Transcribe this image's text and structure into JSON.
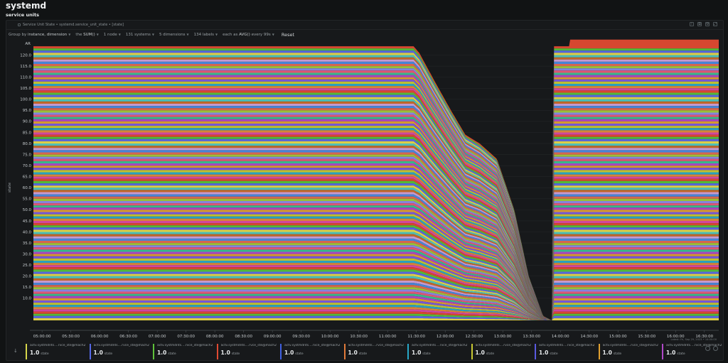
{
  "page": {
    "title": "systemd",
    "subtitle": "service units"
  },
  "card": {
    "title": "Service Unit State • systemd.service_unit_state • [state]",
    "icons": [
      "info-icon",
      "copy-icon",
      "settings-icon",
      "expand-icon"
    ]
  },
  "toolbar": {
    "group_by_label": "Group by",
    "group_by_value": "instance, dimension",
    "the_label": "the",
    "aggregation": "SUM()",
    "nodes": "1 node",
    "systems": "131 systems",
    "dimensions": "5 dimensions",
    "labels": "134 labels",
    "each_as_label": "each as",
    "each_as_value": "AVG()",
    "every": "every 99s",
    "reset": "Reset"
  },
  "chart_data": {
    "type": "area",
    "stacked": true,
    "ylabel": "state",
    "y_unit_label": "AR",
    "ylim": [
      0,
      125
    ],
    "y_ticks": [
      10.0,
      15.0,
      20.0,
      25.0,
      30.0,
      35.0,
      40.0,
      45.0,
      50.0,
      55.0,
      60.0,
      65.0,
      70.0,
      75.0,
      80.0,
      85.0,
      90.0,
      95.0,
      100.0,
      105.0,
      110.0,
      115.0,
      120.0
    ],
    "x_ticks": [
      "05:00:00",
      "05:30:00",
      "06:00:00",
      "06:30:00",
      "07:00:00",
      "07:30:00",
      "08:00:00",
      "08:30:00",
      "09:00:00",
      "09:30:00",
      "10:00:00",
      "10:30:00",
      "11:00:00",
      "11:30:00",
      "12:00:00",
      "12:30:00",
      "13:00:00",
      "13:30:00",
      "14:00:00",
      "14:30:00",
      "15:00:00",
      "15:30:00",
      "16:00:00",
      "16:30:00"
    ],
    "x_range_hours": [
      4.85,
      16.75
    ],
    "series_count": 124,
    "series_value_each": 1.0,
    "stack_total_profile": [
      {
        "t": 4.85,
        "total": 124
      },
      {
        "t": 11.45,
        "total": 124
      },
      {
        "t": 11.55,
        "total": 121
      },
      {
        "t": 11.8,
        "total": 109
      },
      {
        "t": 12.1,
        "total": 95
      },
      {
        "t": 12.35,
        "total": 84
      },
      {
        "t": 12.6,
        "total": 80
      },
      {
        "t": 12.9,
        "total": 73
      },
      {
        "t": 13.2,
        "total": 50
      },
      {
        "t": 13.45,
        "total": 20
      },
      {
        "t": 13.7,
        "total": 2
      },
      {
        "t": 13.85,
        "total": 0
      },
      {
        "t": 13.88,
        "total": 124
      },
      {
        "t": 14.15,
        "total": 124
      },
      {
        "t": 14.17,
        "total": 127
      },
      {
        "t": 16.75,
        "total": 127
      }
    ],
    "grid": true,
    "legend": "bottom"
  },
  "legend": {
    "items": [
      {
        "name": "actv.systmdnts....rvce_ste@mach2",
        "value": "1.0",
        "unit": "state",
        "color": "#d6d64a"
      },
      {
        "name": "actv.systmdnts....rvce_ste@mach2",
        "value": "1.0",
        "unit": "state",
        "color": "#5568e8"
      },
      {
        "name": "actv.systmdnts....rvce_ste@mach2",
        "value": "1.0",
        "unit": "state",
        "color": "#5ec23a"
      },
      {
        "name": "actv.systmdnts....rvce_ste@mach2",
        "value": "1.0",
        "unit": "state",
        "color": "#e04a32"
      },
      {
        "name": "actv.systmdnts....rvce_ste@mach2",
        "value": "1.0",
        "unit": "state",
        "color": "#4060e0"
      },
      {
        "name": "actv.systmdnts....rvce_ste@mach2",
        "value": "1.0",
        "unit": "state",
        "color": "#e07a3a"
      },
      {
        "name": "actv.systmdnts....rvce_ste@mach2",
        "value": "1.0",
        "unit": "state",
        "color": "#28a8c8"
      },
      {
        "name": "actv.systmdnts....rvce_ste@mach2",
        "value": "1.0",
        "unit": "state",
        "color": "#c8c832"
      },
      {
        "name": "actv.systmdnts....rvce_ste@mach2",
        "value": "1.0",
        "unit": "state",
        "color": "#5a5ae0"
      },
      {
        "name": "actv.systmdnts....rvce_ste@mach2",
        "value": "1.0",
        "unit": "state",
        "color": "#e0a030"
      },
      {
        "name": "actv.systmdnts....rvce_ste@mach2",
        "value": "1.0",
        "unit": "state",
        "color": "#b048c8"
      }
    ]
  },
  "latest": "Latest: Fri, Sep 29, 2023 • 14:00:00",
  "colors": {
    "background": "#111314",
    "card": "#17191b",
    "text": "#d8dcde",
    "muted": "#8b9296"
  }
}
